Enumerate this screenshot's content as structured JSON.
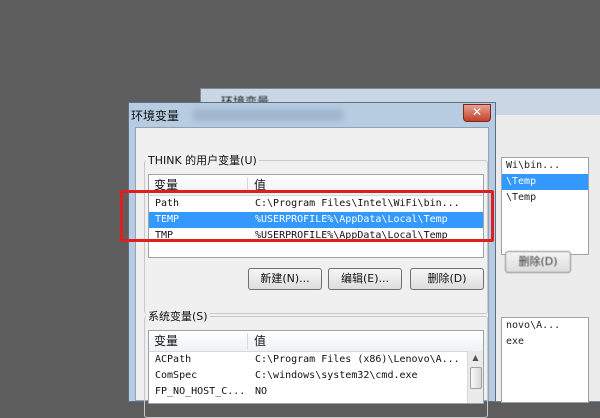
{
  "background_window": {
    "title": "环境变量",
    "user_rows": [
      "Wi\\bin...",
      "\\Temp",
      "\\Temp"
    ],
    "delete_label": "删除(D)",
    "system_rows": [
      "novo\\A...",
      "exe"
    ]
  },
  "dialog": {
    "title": "环境变量",
    "close_glyph": "✕",
    "user_group_label": "THINK 的用户变量(U)",
    "columns": {
      "variable": "变量",
      "value": "值"
    },
    "user_vars": [
      {
        "name": "Path",
        "value": "C:\\Program Files\\Intel\\WiFi\\bin..."
      },
      {
        "name": "TEMP",
        "value": "%USERPROFILE%\\AppData\\Local\\Temp"
      },
      {
        "name": "TMP",
        "value": "%USERPROFILE%\\AppData\\Local\\Temp"
      }
    ],
    "selected_user_var": "TEMP",
    "buttons": {
      "new": "新建(N)...",
      "edit": "编辑(E)...",
      "delete": "删除(D)"
    },
    "system_group_label": "系统变量(S)",
    "system_vars": [
      {
        "name": "ACPath",
        "value": "C:\\Program Files (x86)\\Lenovo\\A..."
      },
      {
        "name": "ComSpec",
        "value": "C:\\windows\\system32\\cmd.exe"
      },
      {
        "name": "FP_NO_HOST_C...",
        "value": "NO"
      }
    ]
  },
  "colors": {
    "selection": "#3399ff",
    "highlight_box": "#e01e1e",
    "title_bar": "#b7cbe1"
  },
  "icons": [
    "close-icon",
    "scroll-up-icon"
  ]
}
